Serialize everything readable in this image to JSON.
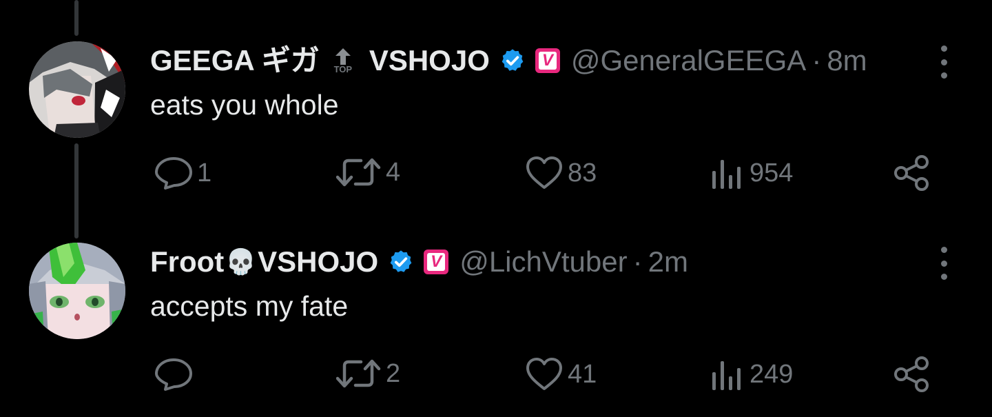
{
  "colors": {
    "background": "#000000",
    "text_primary": "#e7e9ea",
    "text_secondary": "#71767b",
    "verified_blue": "#1d9bf0",
    "vshojo_pink": "#e8287e"
  },
  "tweets": [
    {
      "display_name": "GEEGA ギガ",
      "top_badge": "TOP",
      "display_name_suffix": "VSHOJO",
      "verified": true,
      "affiliate_badge_letter": "V",
      "handle": "@GeneralGEEGA",
      "separator": "·",
      "time": "8m",
      "text": "eats you whole",
      "replies": "1",
      "retweets": "4",
      "likes": "83",
      "views": "954",
      "icons": [
        "reply-icon",
        "retweet-icon",
        "like-icon",
        "views-icon",
        "share-icon",
        "more-icon"
      ]
    },
    {
      "display_name": "Froot",
      "name_emoji": "💀",
      "display_name_suffix": "VSHOJO",
      "verified": true,
      "affiliate_badge_letter": "V",
      "handle": "@LichVtuber",
      "separator": "·",
      "time": "2m",
      "text": "accepts my fate",
      "replies": "",
      "retweets": "2",
      "likes": "41",
      "views": "249",
      "icons": [
        "reply-icon",
        "retweet-icon",
        "like-icon",
        "views-icon",
        "share-icon",
        "more-icon"
      ]
    }
  ]
}
